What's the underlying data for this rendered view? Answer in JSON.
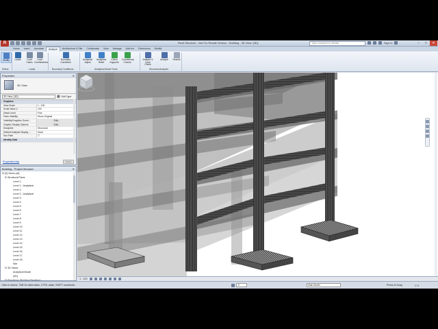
{
  "title_bar": {
    "app_letter": "R",
    "title": "Revit Structure - Not For Resale Version -     Building - 3D View: {3D}",
    "search_placeholder": "Type a keyword or phrase",
    "sign_in": "Sign In",
    "win_min": "–",
    "win_max": "□",
    "win_close": "✕"
  },
  "ribbon_tabs": [
    "Home",
    "Insert",
    "Annotate",
    "Analyze",
    "Architecture & Site",
    "Collaborate",
    "View",
    "Manage",
    "Add-Ins",
    "Extensions",
    "Modify"
  ],
  "active_tab_index": 3,
  "ribbon": {
    "buttons": [
      {
        "label": "Modify",
        "color": "#4d7fc4"
      },
      {
        "label": "Loads",
        "color": "#2f6aa8"
      },
      {
        "label": "Load Cases",
        "color": "#7a8ca4"
      },
      {
        "label": "Load Combinations",
        "color": "#7a8ca4"
      },
      {
        "label": "Boundary Conditions",
        "color": "#3b6fae"
      },
      {
        "label": "Analytical Adjust",
        "color": "#3f7fc7"
      },
      {
        "label": "Analytical Reset",
        "color": "#3f7fc7"
      },
      {
        "label": "Check Supports",
        "color": "#3aa04a"
      },
      {
        "label": "Consistency Checks",
        "color": "#3aa04a"
      },
      {
        "label": "Analyze & Code Check",
        "color": "#4e6fa8"
      },
      {
        "label": "Analyze",
        "color": "#4e6fa8"
      },
      {
        "label": "Results",
        "color": "#9aa6b8"
      }
    ],
    "panels": [
      "Select",
      "Loads",
      "Boundary Conditions",
      "Analytical Model Tools",
      "Structural Analysis"
    ]
  },
  "properties": {
    "title": "Properties",
    "type_name": "3D View",
    "view_selector": "3D View: {3D}",
    "edit_type": "Edit Type",
    "rows": [
      {
        "k": "Graphics",
        "v": "",
        "hdr": true
      },
      {
        "k": "View Scale",
        "v": "1 : 100"
      },
      {
        "k": "Scale Value    1:",
        "v": "100"
      },
      {
        "k": "Detail Level",
        "v": "Fine"
      },
      {
        "k": "Parts Visibility",
        "v": "Show Original"
      },
      {
        "k": "Visibility/Graphics Overri...",
        "v": "Edit...",
        "btn": true
      },
      {
        "k": "Graphic Display Options",
        "v": "Edit...",
        "btn": true
      },
      {
        "k": "Discipline",
        "v": "Structural"
      },
      {
        "k": "Default Analysis Display ...",
        "v": "None"
      },
      {
        "k": "Sun Path",
        "v": "☐"
      },
      {
        "k": "Identity Data",
        "v": "",
        "hdr": true
      }
    ],
    "help_link": "Properties help",
    "apply": "Apply"
  },
  "project_browser": {
    "title": "Building - Project Browser",
    "items": [
      {
        "t": "⊟ [0] Views (all)",
        "indent": 2
      },
      {
        "t": "⊟ Structural Plans",
        "indent": 6
      },
      {
        "t": "Level 1",
        "indent": 18
      },
      {
        "t": "Level 1 - Analytical",
        "indent": 18
      },
      {
        "t": "Level 2",
        "indent": 18
      },
      {
        "t": "Level 2 - Analytical",
        "indent": 18
      },
      {
        "t": "Level 3",
        "indent": 18
      },
      {
        "t": "Level 4",
        "indent": 18
      },
      {
        "t": "Level 5",
        "indent": 18
      },
      {
        "t": "Level 6",
        "indent": 18
      },
      {
        "t": "Level 7",
        "indent": 18
      },
      {
        "t": "Level 8",
        "indent": 18
      },
      {
        "t": "Level 9",
        "indent": 18
      },
      {
        "t": "Level 10",
        "indent": 18
      },
      {
        "t": "Level 11",
        "indent": 18
      },
      {
        "t": "Level 12",
        "indent": 18
      },
      {
        "t": "Level 13",
        "indent": 18
      },
      {
        "t": "Level 14",
        "indent": 18
      },
      {
        "t": "Level 15",
        "indent": 18
      },
      {
        "t": "Level 16",
        "indent": 18
      },
      {
        "t": "Level 17",
        "indent": 18
      },
      {
        "t": "Level 18",
        "indent": 18
      },
      {
        "t": "Site",
        "indent": 18
      },
      {
        "t": "⊟ 3D Views",
        "indent": 6
      },
      {
        "t": "Analytical Model",
        "indent": 18
      },
      {
        "t": "{3D}",
        "indent": 18
      },
      {
        "t": "⊟ Elevations (Building Elevation)",
        "indent": 6
      },
      {
        "t": "East",
        "indent": 18
      }
    ]
  },
  "view_control": {
    "scale": "1 : 100"
  },
  "status": {
    "message": "Click to select, TAB for alternates, CTRL adds, SHIFT unselects.",
    "workset_value": ":0",
    "model": "Main Model",
    "press_drag": "Press & Drag",
    "filter_count": "0"
  }
}
